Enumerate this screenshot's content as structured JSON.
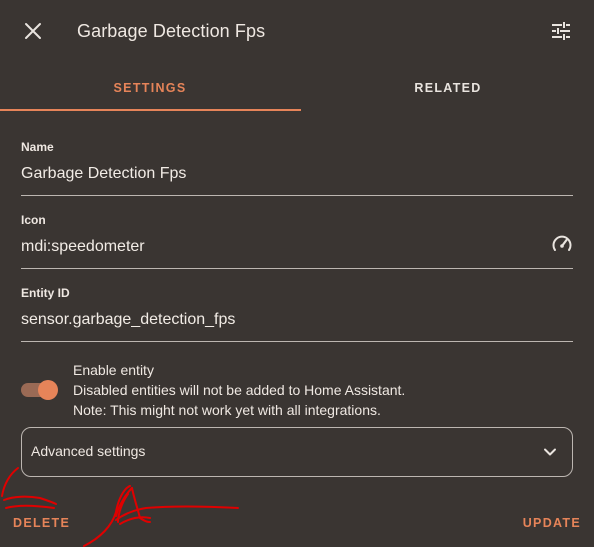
{
  "dialog": {
    "title": "Garbage Detection Fps",
    "close_icon": "close-icon",
    "settings_icon": "tune-icon"
  },
  "tabs": [
    {
      "label": "SETTINGS",
      "active": true
    },
    {
      "label": "RELATED",
      "active": false
    }
  ],
  "fields": {
    "name": {
      "label": "Name",
      "value": "Garbage Detection Fps"
    },
    "icon": {
      "label": "Icon",
      "value": "mdi:speedometer",
      "trailing_icon": "speedometer-icon"
    },
    "entity_id": {
      "label": "Entity ID",
      "value": "sensor.garbage_detection_fps"
    }
  },
  "toggle": {
    "enabled": true,
    "line1": "Enable entity",
    "line2": "Disabled entities will not be added to Home Assistant.",
    "line3": "Note: This might not work yet with all integrations."
  },
  "advanced": {
    "label": "Advanced settings",
    "expand_icon": "chevron-down-icon"
  },
  "actions": {
    "delete_label": "DELETE",
    "update_label": "UPDATE"
  },
  "colors": {
    "background": "#3a3532",
    "accent": "#e68459",
    "text": "#efe8e2",
    "annotation": "#e00000"
  }
}
